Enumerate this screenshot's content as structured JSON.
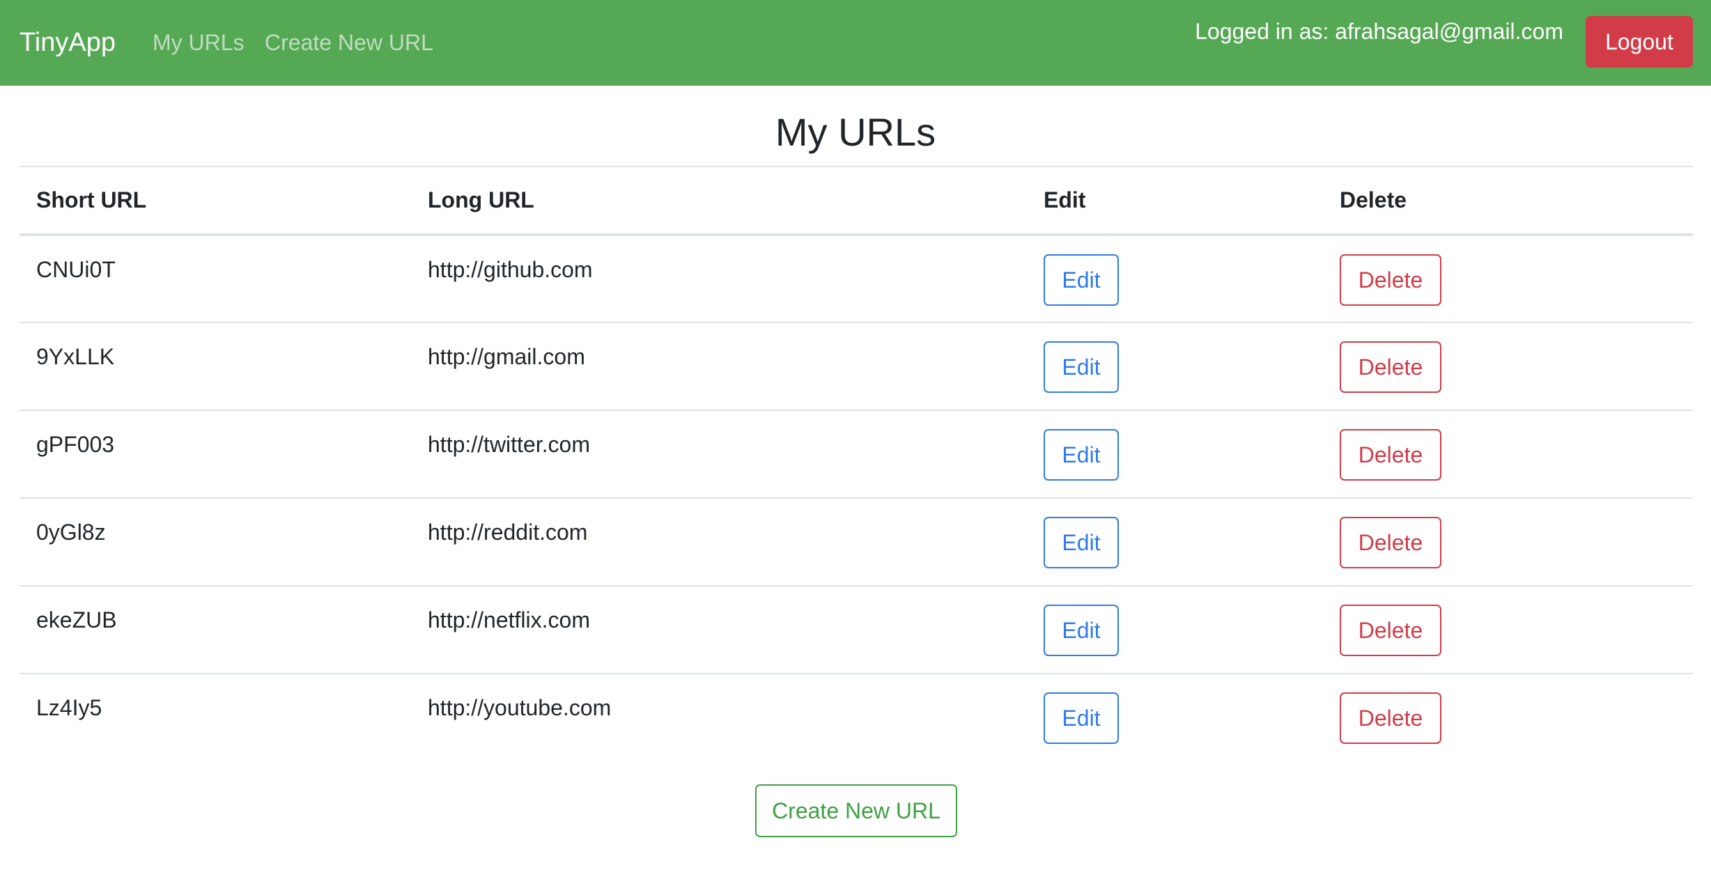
{
  "colors": {
    "navbar": "#55a854",
    "logout": "#d23b48",
    "edit": "#2f7be8",
    "delete": "#d23b48",
    "create": "#3fa044"
  },
  "navbar": {
    "brand": "TinyApp",
    "links": [
      "My URLs",
      "Create New URL"
    ],
    "logged_in_text": "Logged in as: afrahsagal@gmail.com",
    "logout_label": "Logout"
  },
  "main": {
    "title": "My URLs",
    "table": {
      "headers": [
        "Short URL",
        "Long URL",
        "Edit",
        "Delete"
      ],
      "rows": [
        {
          "short": "CNUi0T",
          "long": "http://github.com",
          "edit": "Edit",
          "delete": "Delete"
        },
        {
          "short": "9YxLLK",
          "long": "http://gmail.com",
          "edit": "Edit",
          "delete": "Delete"
        },
        {
          "short": "gPF003",
          "long": "http://twitter.com",
          "edit": "Edit",
          "delete": "Delete"
        },
        {
          "short": "0yGl8z",
          "long": "http://reddit.com",
          "edit": "Edit",
          "delete": "Delete"
        },
        {
          "short": "ekeZUB",
          "long": "http://netflix.com",
          "edit": "Edit",
          "delete": "Delete"
        },
        {
          "short": "Lz4Iy5",
          "long": "http://youtube.com",
          "edit": "Edit",
          "delete": "Delete"
        }
      ]
    },
    "create_button_label": "Create New URL"
  }
}
